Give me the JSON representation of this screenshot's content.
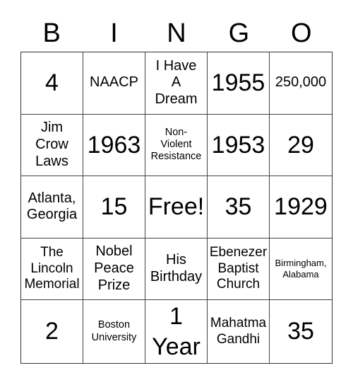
{
  "header": {
    "letters": [
      "B",
      "I",
      "N",
      "G",
      "O"
    ]
  },
  "cells": [
    {
      "text": "4",
      "size": "xl"
    },
    {
      "text": "NAACP",
      "size": "l"
    },
    {
      "text": "I Have\nA\nDream",
      "size": "l"
    },
    {
      "text": "1955",
      "size": "xl"
    },
    {
      "text": "250,000",
      "size": "l"
    },
    {
      "text": "Jim\nCrow\nLaws",
      "size": "l"
    },
    {
      "text": "1963",
      "size": "xl"
    },
    {
      "text": "Non-\nViolent\nResistance",
      "size": "s"
    },
    {
      "text": "1953",
      "size": "xl"
    },
    {
      "text": "29",
      "size": "xl"
    },
    {
      "text": "Atlanta,\nGeorgia",
      "size": "l"
    },
    {
      "text": "15",
      "size": "xl"
    },
    {
      "text": "Free!",
      "size": "xl"
    },
    {
      "text": "35",
      "size": "xl"
    },
    {
      "text": "1929",
      "size": "xl"
    },
    {
      "text": "The\nLincoln\nMemorial",
      "size": "m"
    },
    {
      "text": "Nobel\nPeace\nPrize",
      "size": "l"
    },
    {
      "text": "His\nBirthday",
      "size": "l"
    },
    {
      "text": "Ebenezer\nBaptist\nChurch",
      "size": "m"
    },
    {
      "text": "Birmingham,\nAlabama",
      "size": "xs"
    },
    {
      "text": "2",
      "size": "xl"
    },
    {
      "text": "Boston\nUniversity",
      "size": "s"
    },
    {
      "text": "1\nYear",
      "size": "xl"
    },
    {
      "text": "Mahatma\nGandhi",
      "size": "m"
    },
    {
      "text": "35",
      "size": "xl"
    }
  ]
}
